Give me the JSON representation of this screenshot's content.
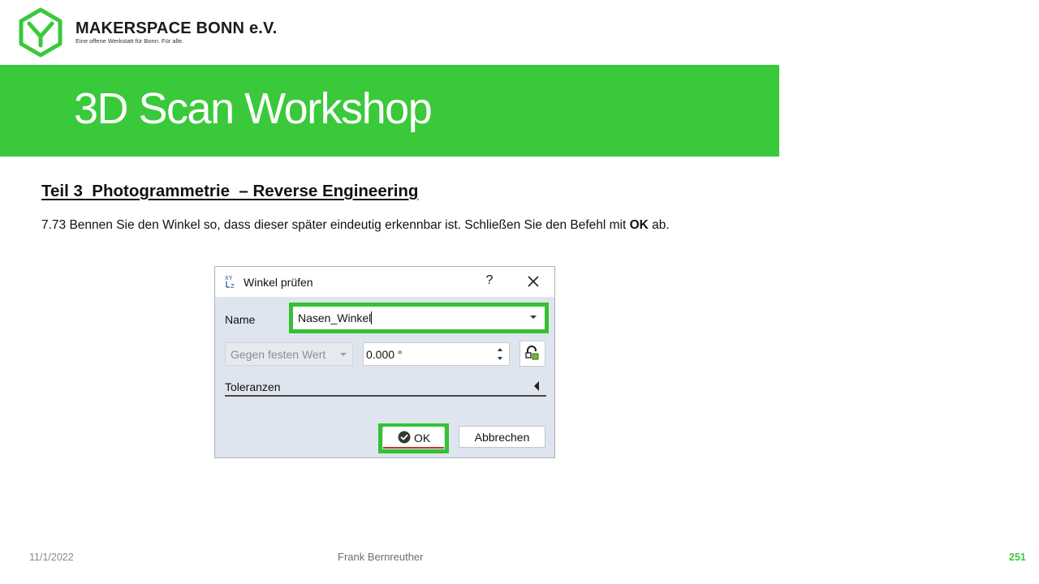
{
  "brand": {
    "name": "MAKERSPACE BONN e.V.",
    "tagline": "Eine offene Werkstatt für Bonn. Für alle.",
    "color": "#3ac93a"
  },
  "banner": {
    "title": "3D Scan Workshop"
  },
  "section": {
    "title": "Teil 3  Photogrammetrie  – Reverse Engineering"
  },
  "instruction": {
    "before": "7.73 Bennen Sie den Winkel so, dass dieser später eindeutig erkennbar ist. Schließen Sie den Befehl mit ",
    "bold": "OK",
    "after": " ab."
  },
  "dialog": {
    "icon": "angle-measure-icon",
    "title": "Winkel prüfen",
    "help_label": "?",
    "name_label": "Name",
    "name_value": "Nasen_Winkel",
    "mode_value": "Gegen festen Wert",
    "angle_value": "0.000 °",
    "tolerances_label": "Toleranzen",
    "ok_label": "OK",
    "cancel_label": "Abbrechen",
    "highlight_color": "#34c234"
  },
  "footer": {
    "date": "11/1/2022",
    "author": "Frank Bernreuther",
    "page": "251"
  }
}
